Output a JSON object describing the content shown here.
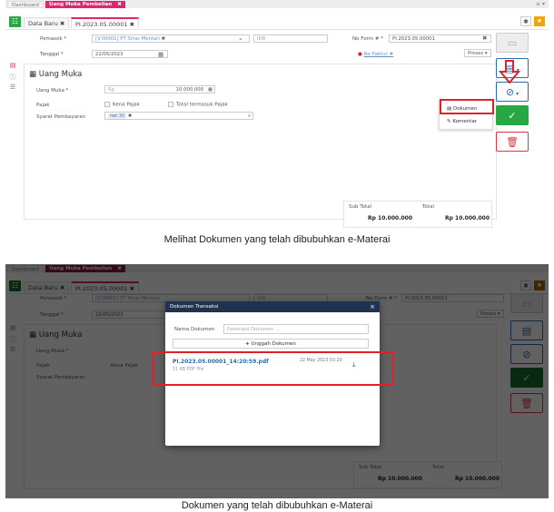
{
  "app": {
    "tab_dashboard": "Dashboard",
    "tab_active": "Uang Muka Pembelian",
    "tab_close": "✖",
    "chevron": "≡ ▾",
    "doc_tab_new": "Data Baru",
    "doc_tab_current": "PI.2023.05.00001",
    "close_glyph": "✖"
  },
  "form": {
    "pemasok_label": "Pemasok *",
    "pemasok_value": "[V.00001] PT Sinar Mentari",
    "currency": "IDR",
    "tanggal_label": "Tanggal *",
    "tanggal_value": "22/05/2023",
    "noform_label": "No Form # *",
    "noform_value": "PI.2023.05.00001",
    "no_faktur_link": "No Faktur #",
    "proses_label": "Proses"
  },
  "panel": {
    "title": "Uang Muka",
    "uang_muka_label": "Uang Muka *",
    "currency_prefix": "Rp",
    "uang_muka_value": "10.000.000",
    "pajak_label": "Pajak",
    "kena_pajak": "Kena Pajak",
    "total_termasuk_pajak": "Total termasuk Pajak",
    "syarat_label": "Syarat Pembayaran",
    "syarat_chip": "net 30"
  },
  "totals": {
    "subtotal_label": "Sub Total",
    "subtotal_value": "Rp 10.000.000",
    "total_label": "Total",
    "total_value": "Rp 10.000.000"
  },
  "dropdown": {
    "dokumen": "Dokumen",
    "komentar": "Komentar"
  },
  "modal": {
    "title": "Dokumen Transaksi",
    "nama_label": "Nama Dokumen",
    "nama_placeholder": "Deskripsi Dokumen ...",
    "add_button": "Unggah Dokumen",
    "file_name": "PI.2023.05.00001_14:20:59.pdf",
    "file_meta": "51 KB PDF File",
    "file_date": "22 May 2023 03:20"
  },
  "captions": {
    "top": "Melihat Dokumen yang telah dibubuhkan e-Materai",
    "bottom": "Dokumen yang telah dibubuhkan e-Materai"
  },
  "colors": {
    "accent_pink": "#e0246f",
    "highlight_red": "#e0202a",
    "primary_blue": "#2b6cb0",
    "modal_header": "#1f3350"
  },
  "icons": {
    "menu": "grid-icon",
    "settings": "gear-icon",
    "star": "star-icon",
    "search": "search-icon",
    "calendar": "calendar-icon",
    "save": "save-icon",
    "document": "document-icon",
    "attachment": "paperclip-icon",
    "trash": "trash-icon",
    "download": "download-icon"
  }
}
